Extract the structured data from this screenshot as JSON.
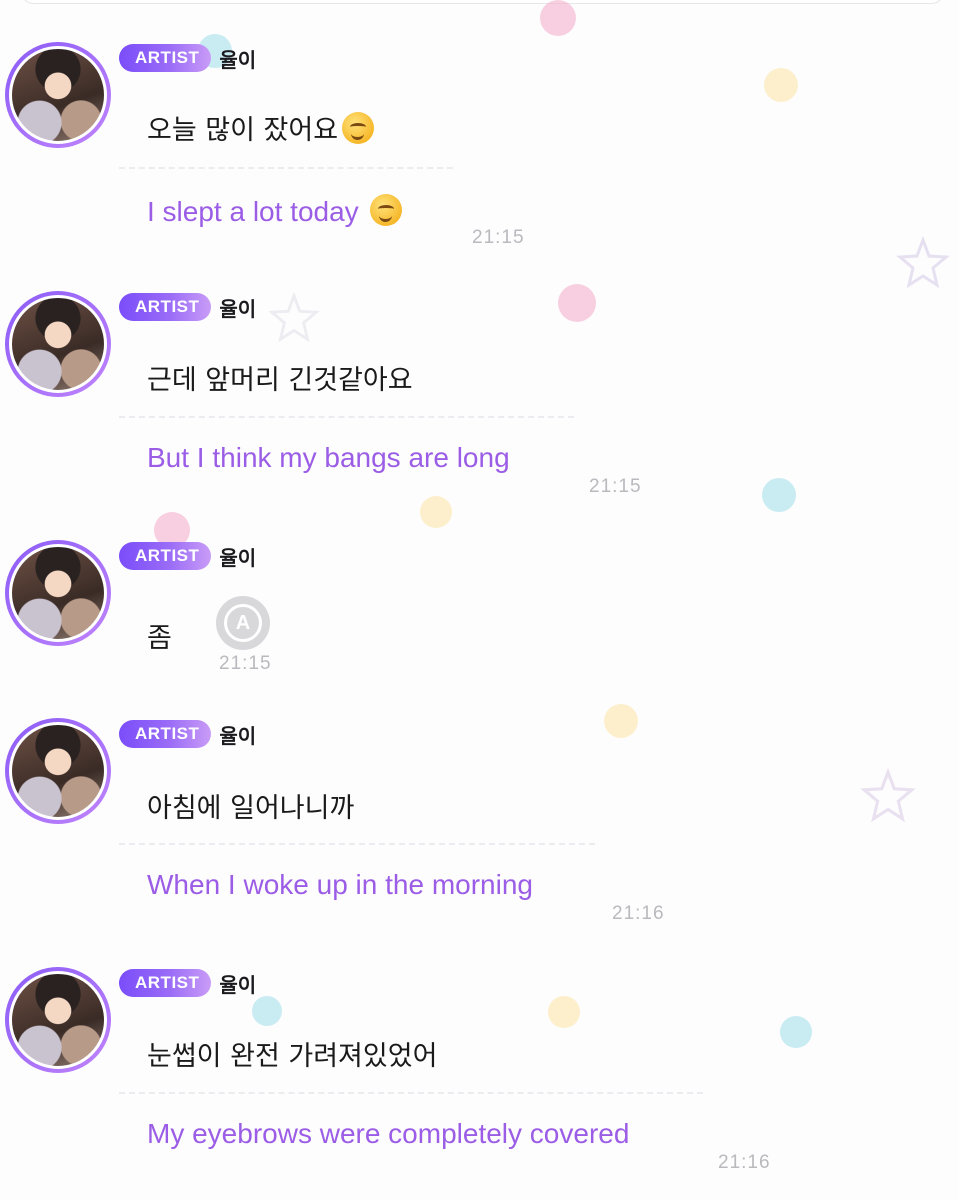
{
  "artist_badge": "ARTIST",
  "artist_name": "율이",
  "messages": [
    {
      "original": "오늘 많이 잤어요",
      "translation": "I slept a lot today",
      "time": "21:15",
      "emoji": "melting-face-icon"
    },
    {
      "original": "근데 앞머리 긴것같아요",
      "translation": "But I think my bangs are long",
      "time": "21:15"
    },
    {
      "original": "좀",
      "time": "21:15"
    },
    {
      "original": "아침에 일어나니까",
      "translation": "When I woke up in the morning",
      "time": "21:16"
    },
    {
      "original": "눈썹이 완전 가려져있었어",
      "translation": "My eyebrows were completely covered",
      "time": "21:16"
    }
  ],
  "translate_button": {
    "glyph": "A",
    "icon": "translate-icon"
  },
  "colors": {
    "badge_gradient_start": "#7a4dfa",
    "badge_gradient_end": "#c99cf7",
    "translation_text": "#9b5de5",
    "timestamp": "#b9b9be",
    "avatar_ring": "#8b5cf6"
  }
}
